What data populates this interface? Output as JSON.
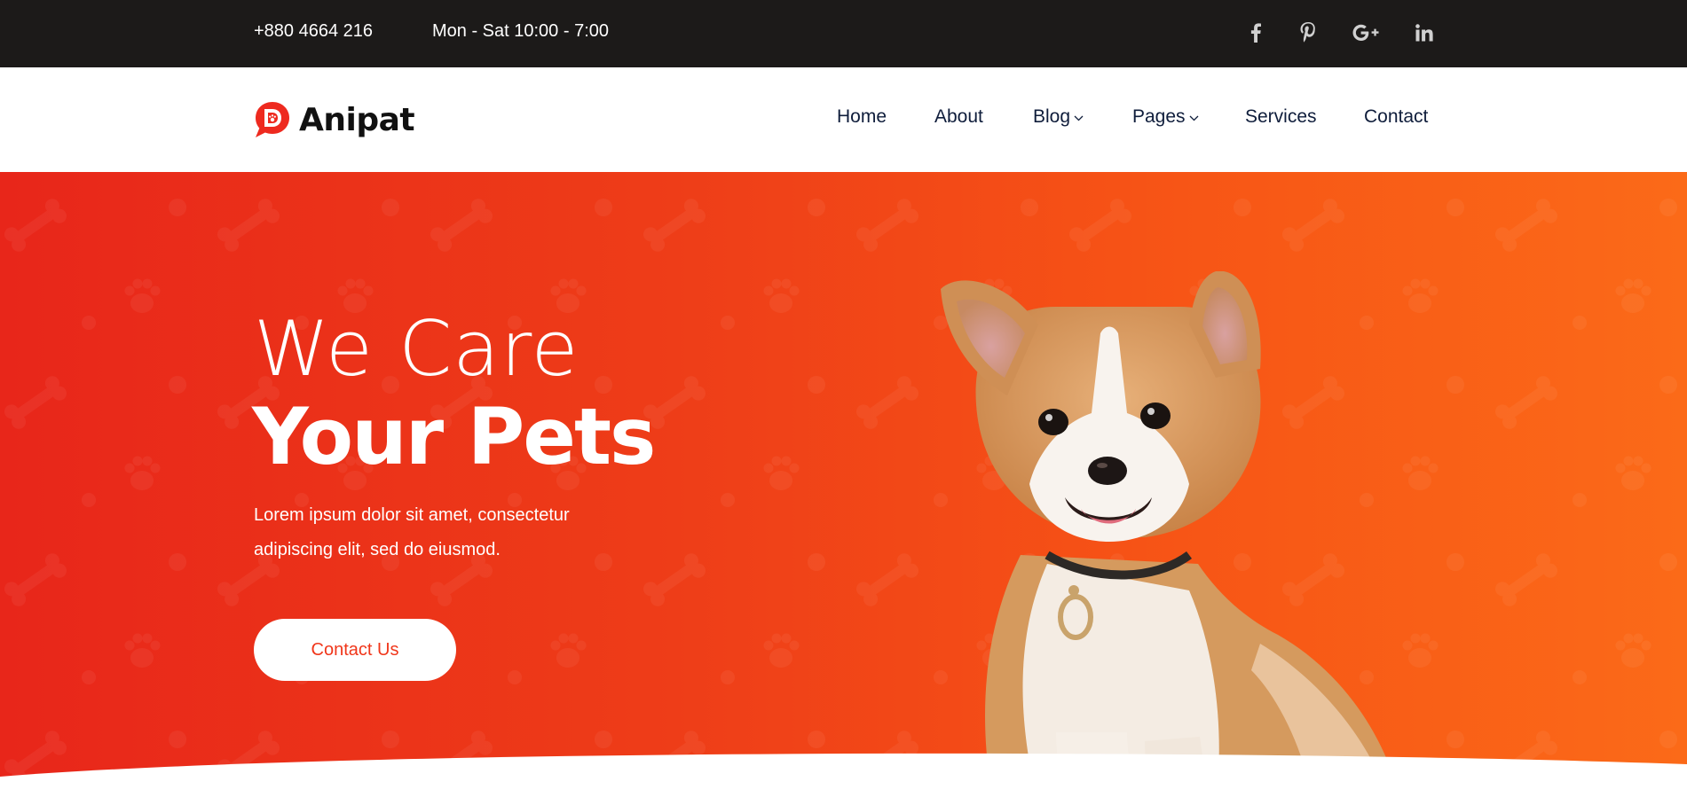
{
  "topbar": {
    "phone": "+880 4664 216",
    "hours": "Mon - Sat 10:00 - 7:00",
    "social": [
      "facebook-icon",
      "pinterest-icon",
      "google-plus-icon",
      "linkedin-icon"
    ]
  },
  "header": {
    "logo_text": "Anipat",
    "nav": {
      "home": "Home",
      "about": "About",
      "blog": "Blog",
      "pages": "Pages",
      "services": "Services",
      "contact": "Contact"
    }
  },
  "hero": {
    "title_light": "We Care",
    "title_bold": "Your Pets",
    "description": "Lorem ipsum dolor sit amet, consectetur adipiscing elit, sed do eiusmod.",
    "button_label": "Contact Us"
  },
  "colors": {
    "topbar_bg": "#1c1a19",
    "hero_gradient_start": "#e8261a",
    "hero_gradient_end": "#fb6a18",
    "accent": "#f0361a",
    "nav_text": "#0f1d3b"
  }
}
